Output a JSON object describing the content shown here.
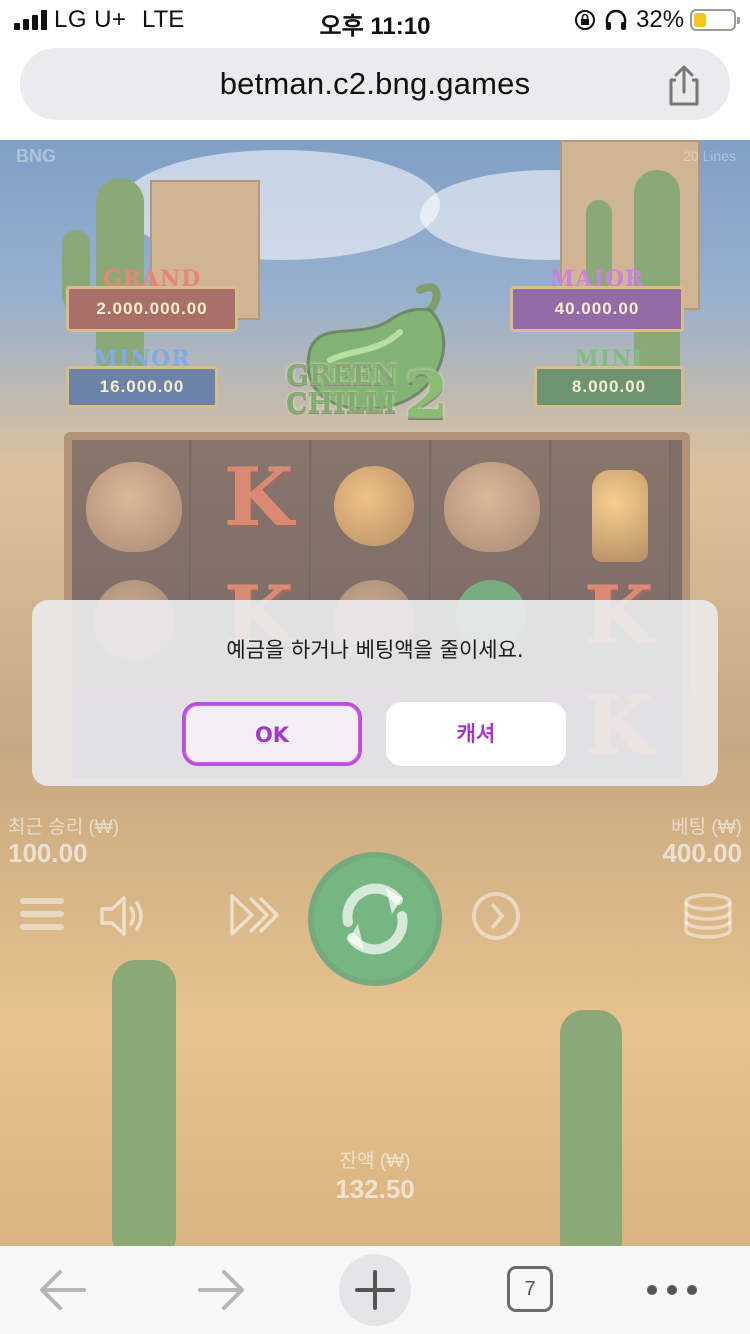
{
  "status_bar": {
    "carrier": "LG U+",
    "network": "LTE",
    "time": "오후 11:10",
    "battery_percent": "32%",
    "battery_level": 0.32,
    "icons": [
      "signal-icon",
      "orientation-lock-icon",
      "headphones-icon",
      "battery-icon"
    ]
  },
  "browser": {
    "url": "betman.c2.bng.games",
    "share_icon": "share-icon"
  },
  "game": {
    "provider_logo": "BNG",
    "lines_label": "20 Lines",
    "jackpots": {
      "grand": {
        "title": "GRAND",
        "amount": "2.000.000.00"
      },
      "major": {
        "title": "MAJOR",
        "amount": "40.000.00"
      },
      "minor": {
        "title": "MINOR",
        "amount": "16.000.00"
      },
      "mini": {
        "title": "MINI",
        "amount": "8.000.00"
      }
    },
    "logo": {
      "line1": "GREEN",
      "line2": "CHILLI",
      "number": "2"
    },
    "reel_symbols": {
      "k": "K",
      "icons": [
        "hen-icon",
        "maracas-icon",
        "bottle-icon"
      ]
    },
    "last_win": {
      "label": "최근 승리 (₩)",
      "value": "100.00"
    },
    "bet": {
      "label": "베팅 (₩)",
      "value": "400.00"
    },
    "balance": {
      "label": "잔액 (₩)",
      "value": "132.50"
    },
    "controls": [
      "menu-icon",
      "sound-icon",
      "turbo-icon",
      "spin-icon",
      "autoplay-icon",
      "coins-icon"
    ]
  },
  "dialog": {
    "message": "예금을 하거나 베팅액을 줄이세요.",
    "ok_label": "OK",
    "cancel_label": "캐셔"
  },
  "toolbar": {
    "tab_count": "7",
    "icons": [
      "back-arrow-icon",
      "forward-arrow-icon",
      "new-tab-plus-icon",
      "tabs-icon",
      "more-icon"
    ]
  }
}
